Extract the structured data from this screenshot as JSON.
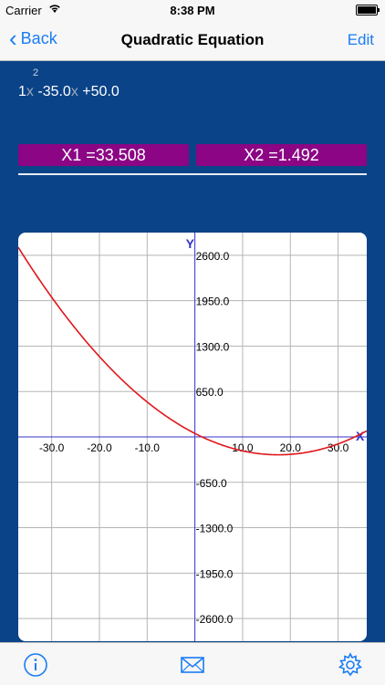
{
  "status_bar": {
    "carrier": "Carrier",
    "time": "8:38 PM"
  },
  "nav": {
    "back_label": "Back",
    "title": "Quadratic Equation",
    "edit_label": "Edit"
  },
  "equation": {
    "coef_a": "1",
    "var_a": "x",
    "exponent": "2",
    "coef_b": "-35.0",
    "var_b": "x",
    "constant": "+50.0"
  },
  "roots": {
    "x1": "X1 =33.508",
    "x2": "X2 =1.492"
  },
  "graph": {
    "x_axis_label": "X",
    "y_axis_label": "Y",
    "curve_color": "#e0161a",
    "axis_color": "#3333cc",
    "x_ticks": [
      "-30.0",
      "-20.0",
      "-10.0",
      "10.0",
      "20.0",
      "30.0"
    ],
    "y_ticks": [
      "2600.0",
      "1950.0",
      "1300.0",
      "650.0",
      "-650.0",
      "-1300.0",
      "-1950.0",
      "-2600.0"
    ]
  },
  "chart_data": {
    "type": "line",
    "function": "y = x^2 - 35x + 50",
    "xlim": [
      -37,
      36
    ],
    "ylim": [
      -2925,
      2925
    ],
    "x_tick_values": [
      -30,
      -20,
      -10,
      10,
      20,
      30
    ],
    "y_tick_values": [
      2600,
      1950,
      1300,
      650,
      -650,
      -1300,
      -1950,
      -2600
    ]
  },
  "toolbar": {
    "info_icon": "info-icon",
    "mail_icon": "mail-icon",
    "settings_icon": "gear-icon"
  }
}
